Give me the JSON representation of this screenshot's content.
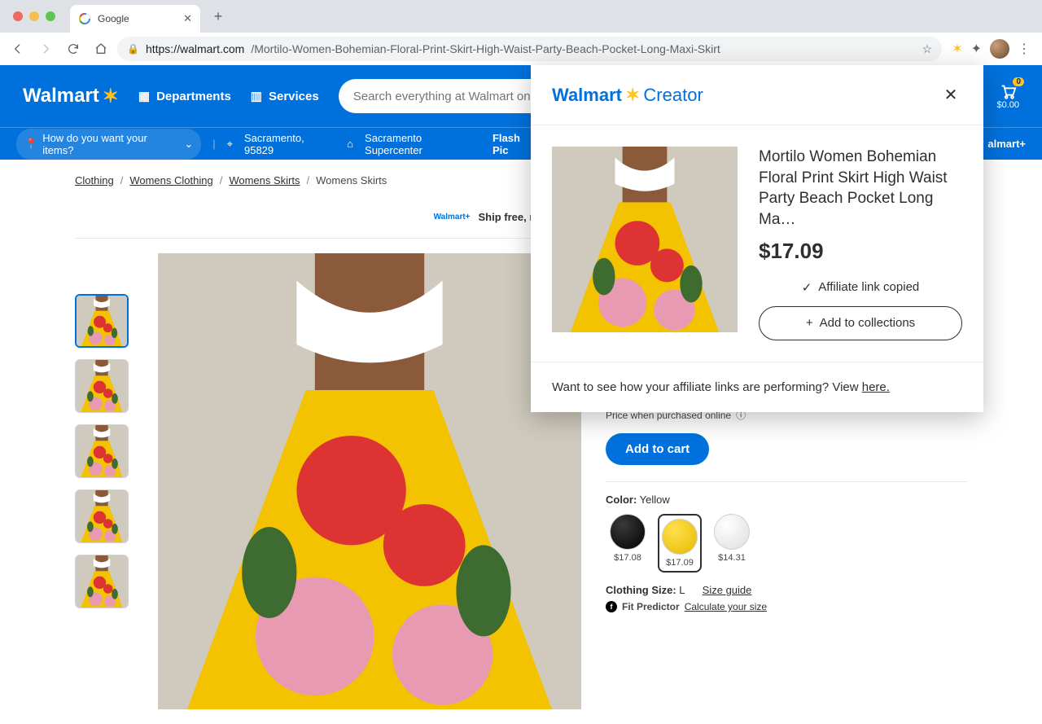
{
  "browser": {
    "tab_title": "Google",
    "url_host": "https://walmart.com",
    "url_path": "/Mortilo-Women-Bohemian-Floral-Print-Skirt-High-Waist-Party-Beach-Pocket-Long-Maxi-Skirt"
  },
  "header": {
    "brand": "Walmart",
    "departments": "Departments",
    "services": "Services",
    "search_placeholder": "Search everything at Walmart online a",
    "cart_count": "0",
    "cart_total": "$0.00"
  },
  "subnav": {
    "how": "How do you want your items?",
    "zip": "Sacramento, 95829",
    "store": "Sacramento Supercenter",
    "flash": "Flash Pic",
    "wmplus": "almart+"
  },
  "crumbs": [
    "Clothing",
    "Womens Clothing",
    "Womens Skirts",
    "Womens Skirts"
  ],
  "shipmsg": "Ship free, no order min*  A",
  "shiptag": "Walmart+",
  "product": {
    "priceNote": "Price when purchased online",
    "addToCart": "Add to cart",
    "colorLabel": "Color:",
    "colorValue": "Yellow",
    "swatches": [
      {
        "price": "$17.08",
        "cls": "sw-black"
      },
      {
        "price": "$17.09",
        "cls": "sw-yellow",
        "selected": true
      },
      {
        "price": "$14.31",
        "cls": "sw-white"
      }
    ],
    "sizeLabel": "Clothing Size:",
    "sizeValue": "L",
    "sizeGuide": "Size guide",
    "fitPredictor": "Fit Predictor",
    "calcSize": "Calculate your size"
  },
  "panel": {
    "logo_wm": "Walmart",
    "logo_cr": "Creator",
    "title": "Mortilo Women Bohemian Floral Print Skirt High Waist Party Beach Pocket Long Ma…",
    "price": "$17.09",
    "copied": "Affiliate link copied",
    "addCollections": "Add to collections",
    "footer_a": "Want to see how your affiliate links are performing? View ",
    "footer_link": "here."
  }
}
